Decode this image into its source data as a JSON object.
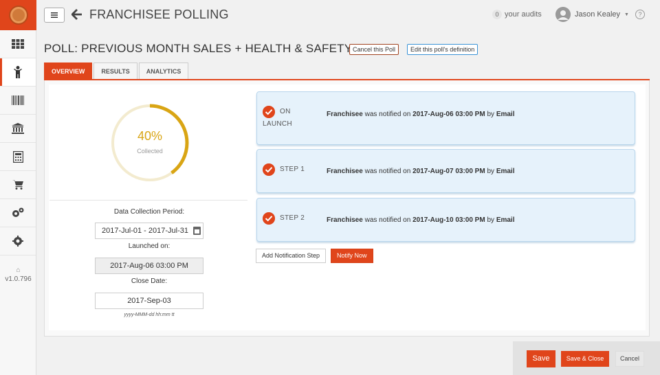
{
  "sidebar": {
    "items": [
      {
        "icon": "grid-icon"
      },
      {
        "icon": "person-icon",
        "active": true
      },
      {
        "icon": "barcode-icon"
      },
      {
        "icon": "bank-icon"
      },
      {
        "icon": "calculator-icon"
      },
      {
        "icon": "cart-icon"
      },
      {
        "icon": "gears-icon"
      },
      {
        "icon": "gear-icon"
      }
    ],
    "version": "v1.0.796"
  },
  "header": {
    "title": "FRANCHISEE POLLING",
    "audit_count": "0",
    "audits_label": "your audits",
    "user_name": "Jason Kealey",
    "help": "?"
  },
  "poll": {
    "title": "POLL: PREVIOUS MONTH SALES + HEALTH & SAFETY",
    "cancel_label": "Cancel this Poll",
    "edit_label": "Edit this poll's definition"
  },
  "tabs": [
    "OVERVIEW",
    "RESULTS",
    "ANALYTICS"
  ],
  "progress": {
    "value": 0.4,
    "percent_label": "40%",
    "caption": "Collected"
  },
  "fields": {
    "period_label": "Data Collection Period:",
    "period_value": "2017-Jul-01 - 2017-Jul-31",
    "launched_label": "Launched on:",
    "launched_value": "2017-Aug-06 03:00 PM",
    "close_label": "Close Date:",
    "close_value": "2017-Sep-03",
    "format_hint": "yyyy-MMM-dd hh:mm tt"
  },
  "steps": [
    {
      "name_line1": "ON",
      "name_line2": "LAUNCH",
      "who": "Franchisee",
      "mid": " was notified on ",
      "when": "2017-Aug-06 03:00 PM",
      "by": " by ",
      "channel": "Email"
    },
    {
      "name_line1": "STEP 1",
      "name_line2": "",
      "who": "Franchisee",
      "mid": " was notified on ",
      "when": "2017-Aug-07 03:00 PM",
      "by": " by ",
      "channel": "Email"
    },
    {
      "name_line1": "STEP 2",
      "name_line2": "",
      "who": "Franchisee",
      "mid": " was notified on ",
      "when": "2017-Aug-10 03:00 PM",
      "by": " by ",
      "channel": "Email"
    }
  ],
  "actions": {
    "add_step": "Add Notification Step",
    "notify_now": "Notify Now"
  },
  "footer": {
    "save": "Save",
    "save_close": "Save & Close",
    "cancel": "Cancel"
  },
  "colors": {
    "accent": "#e0451b",
    "gauge": "#d9a514",
    "step_bg": "#e6f2fb"
  }
}
